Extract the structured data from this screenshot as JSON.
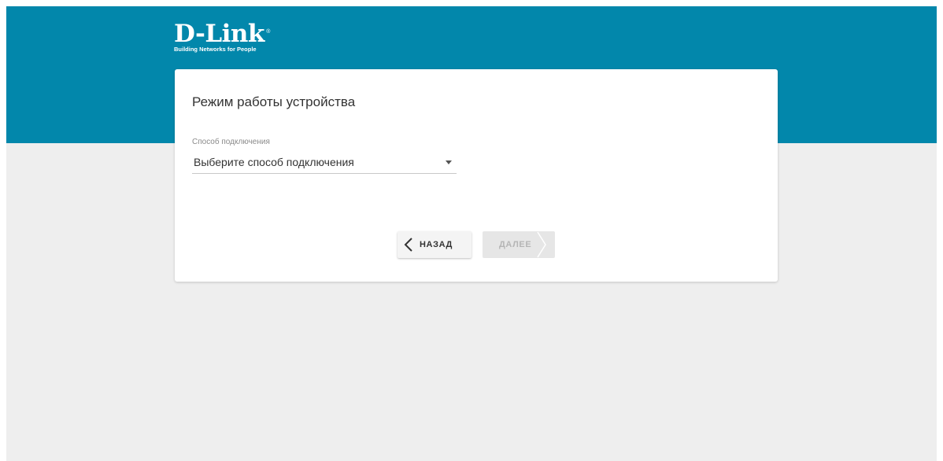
{
  "brand": {
    "logo_text": "D-Link",
    "registered_mark": "®",
    "tagline": "Building Networks for People"
  },
  "card": {
    "title": "Режим работы устройства",
    "connection_field": {
      "label": "Способ подключения",
      "value": "Выберите способ подключения"
    }
  },
  "buttons": {
    "back_label": "НАЗАД",
    "next_label": "ДАЛЕЕ",
    "next_enabled": false
  },
  "colors": {
    "header": "#0287ab",
    "background": "#eeeeee",
    "card": "#ffffff"
  },
  "icons": {
    "back": "chevron-left-icon",
    "next": "chevron-right-icon",
    "dropdown": "caret-down-icon"
  }
}
